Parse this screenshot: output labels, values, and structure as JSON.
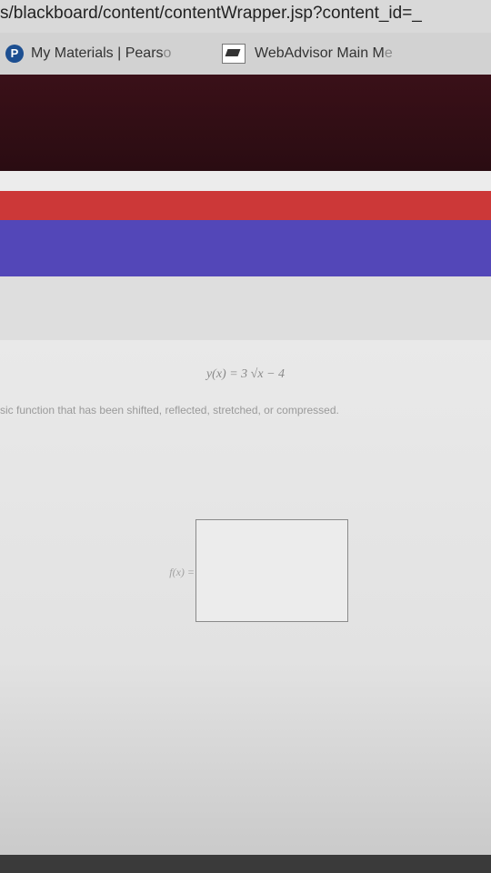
{
  "browser": {
    "url": "s/blackboard/content/contentWrapper.jsp?content_id=_",
    "bookmarks": [
      {
        "label": "My Materials | Pears",
        "fade": "o",
        "icon": "pearson-p-icon"
      },
      {
        "label": "WebAdvisor Main M",
        "fade": "e",
        "icon": "webadvisor-icon"
      }
    ]
  },
  "problem": {
    "equation": "y(x) = 3 √x − 4",
    "instruction": "sic function that has been shifted, reflected, stretched, or compressed.",
    "answer_label": "f(x) ="
  },
  "colors": {
    "dark_banner": "#2a0c12",
    "red_strip": "#cc3838",
    "blue_strip": "#5347b8"
  }
}
